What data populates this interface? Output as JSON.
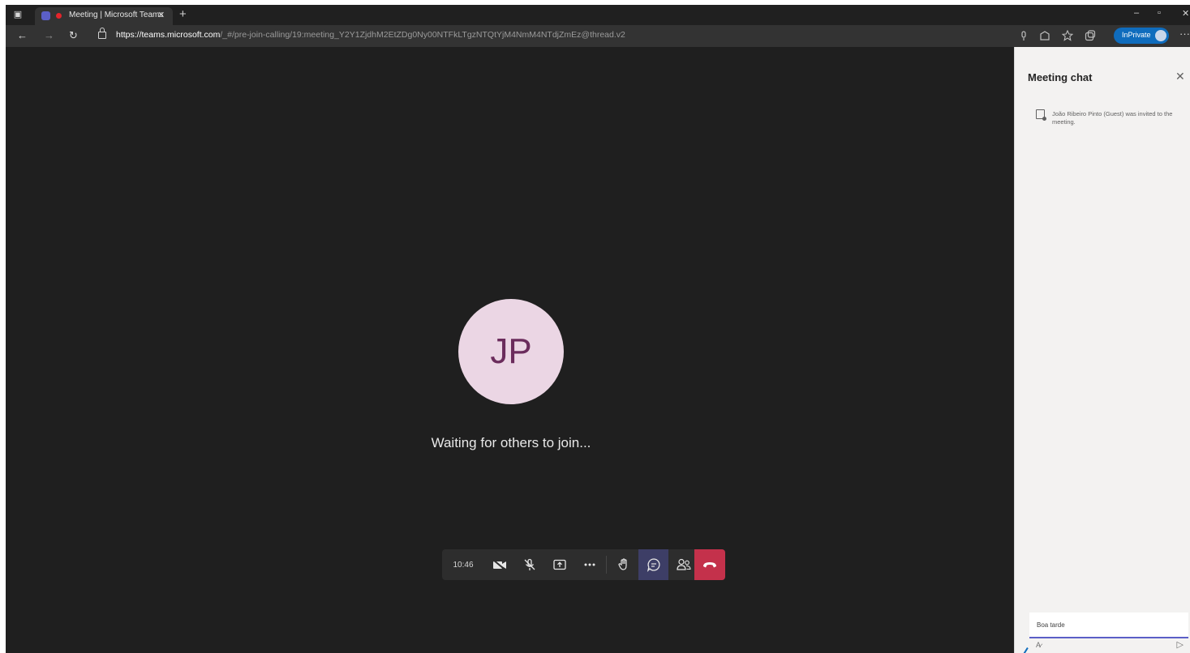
{
  "browser": {
    "tab": {
      "title": "Meeting | Microsoft Teams",
      "close": "✕"
    },
    "new_tab": "+",
    "window_controls": {
      "minimize": "–",
      "maximize": "▫",
      "close": "✕"
    },
    "url_host": "https://teams.microsoft.com",
    "url_rest": "/_#/pre-join-calling/19:meeting_Y2Y1ZjdhM2EtZDg0Ny00NTFkLTgzNTQtYjM4NmM4NTdjZmEz@thread.v2",
    "inprivate_label": "InPrivate",
    "icons": {
      "back": "←",
      "forward": "→",
      "refresh": "↻",
      "more": "···"
    }
  },
  "meeting": {
    "avatar_initials": "JP",
    "waiting_text": "Waiting for others to join...",
    "toolbar": {
      "time": "10:46"
    }
  },
  "chat": {
    "title": "Meeting chat",
    "close": "✕",
    "system_message": "João Ribeiro Pinto (Guest) was invited to the meeting.",
    "compose_text": "Boa tarde"
  },
  "colors": {
    "stage_bg": "#1f1f1f",
    "avatar_bg": "#ebd6e4",
    "avatar_text": "#6b2c5c",
    "active_button": "#3d3e66",
    "hangup": "#c4314b",
    "inprivate": "#0f6cbd"
  }
}
